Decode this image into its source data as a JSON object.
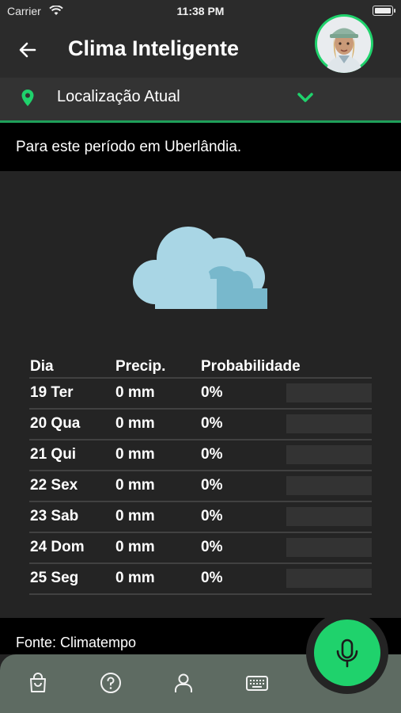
{
  "status_bar": {
    "carrier": "Carrier",
    "time": "11:38 PM"
  },
  "header": {
    "title": "Clima Inteligente",
    "back_icon": "arrow-left-icon"
  },
  "location": {
    "label": "Localização Atual",
    "icon": "map-pin-icon",
    "dropdown_icon": "chevron-down-icon"
  },
  "period": {
    "text": "Para este período em Uberlândia."
  },
  "weather": {
    "icon": "cloud-icon"
  },
  "forecast": {
    "headers": [
      "Dia",
      "Precip.",
      "Probabilidade"
    ],
    "rows": [
      {
        "day": "19 Ter",
        "precip": "0 mm",
        "prob": "0%",
        "prob_value": 0
      },
      {
        "day": "20 Qua",
        "precip": "0 mm",
        "prob": "0%",
        "prob_value": 0
      },
      {
        "day": "21 Qui",
        "precip": "0 mm",
        "prob": "0%",
        "prob_value": 0
      },
      {
        "day": "22 Sex",
        "precip": "0 mm",
        "prob": "0%",
        "prob_value": 0
      },
      {
        "day": "23 Sab",
        "precip": "0 mm",
        "prob": "0%",
        "prob_value": 0
      },
      {
        "day": "24 Dom",
        "precip": "0 mm",
        "prob": "0%",
        "prob_value": 0
      },
      {
        "day": "25 Seg",
        "precip": "0 mm",
        "prob": "0%",
        "prob_value": 0
      }
    ]
  },
  "footer": {
    "source": "Fonte: Climatempo"
  },
  "tabbar": {
    "items": [
      "shopping-bag-icon",
      "help-circle-icon",
      "user-icon",
      "keyboard-icon"
    ]
  },
  "mic": {
    "icon": "microphone-icon"
  },
  "colors": {
    "accent": "#1fd26c",
    "background": "#242424",
    "tabbar": "#5e6b62"
  }
}
